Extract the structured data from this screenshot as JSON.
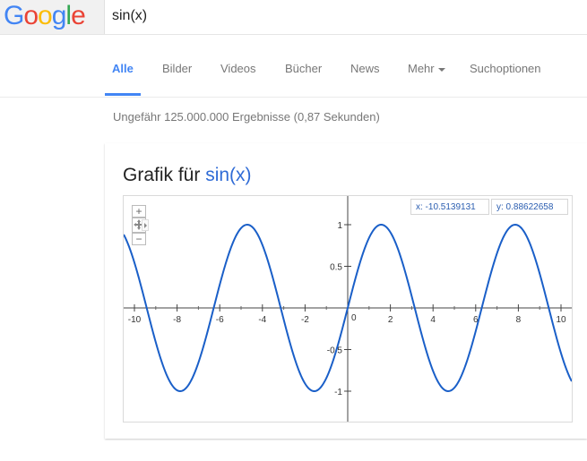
{
  "header": {
    "logo": "Google",
    "query": "sin(x)"
  },
  "tabs": [
    {
      "label": "Alle",
      "active": true
    },
    {
      "label": "Bilder"
    },
    {
      "label": "Videos"
    },
    {
      "label": "Bücher"
    },
    {
      "label": "News"
    },
    {
      "label": "Mehr"
    },
    {
      "label": "Suchoptionen"
    }
  ],
  "stats": "Ungefähr 125.000.000 Ergebnisse (0,87 Sekunden)",
  "card": {
    "title_prefix": "Grafik für",
    "title_fn": "sin(x)"
  },
  "graph": {
    "readout_x": "x: -10.5139131",
    "readout_y": "y: 0.88622658",
    "zoom_in": "+",
    "zoom_out": "−"
  },
  "chart_data": {
    "type": "line",
    "function": "sin(x)",
    "xlim": [
      -10.5,
      10.5
    ],
    "ylim": [
      -1.3,
      1.3
    ],
    "x_ticks": [
      -10,
      -8,
      -6,
      -4,
      -2,
      2,
      4,
      6,
      8,
      10
    ],
    "y_ticks": [
      1,
      0.5,
      -0.5,
      -1
    ],
    "x_tick_labels": [
      "-10",
      "-8",
      "-6",
      "-4",
      "-2",
      "2",
      "4",
      "6",
      "8",
      "10"
    ],
    "y_tick_labels": [
      "1",
      "0.5",
      "-0.5",
      "-1"
    ],
    "zero_label": "0",
    "line_color": "#1a5fc8"
  }
}
